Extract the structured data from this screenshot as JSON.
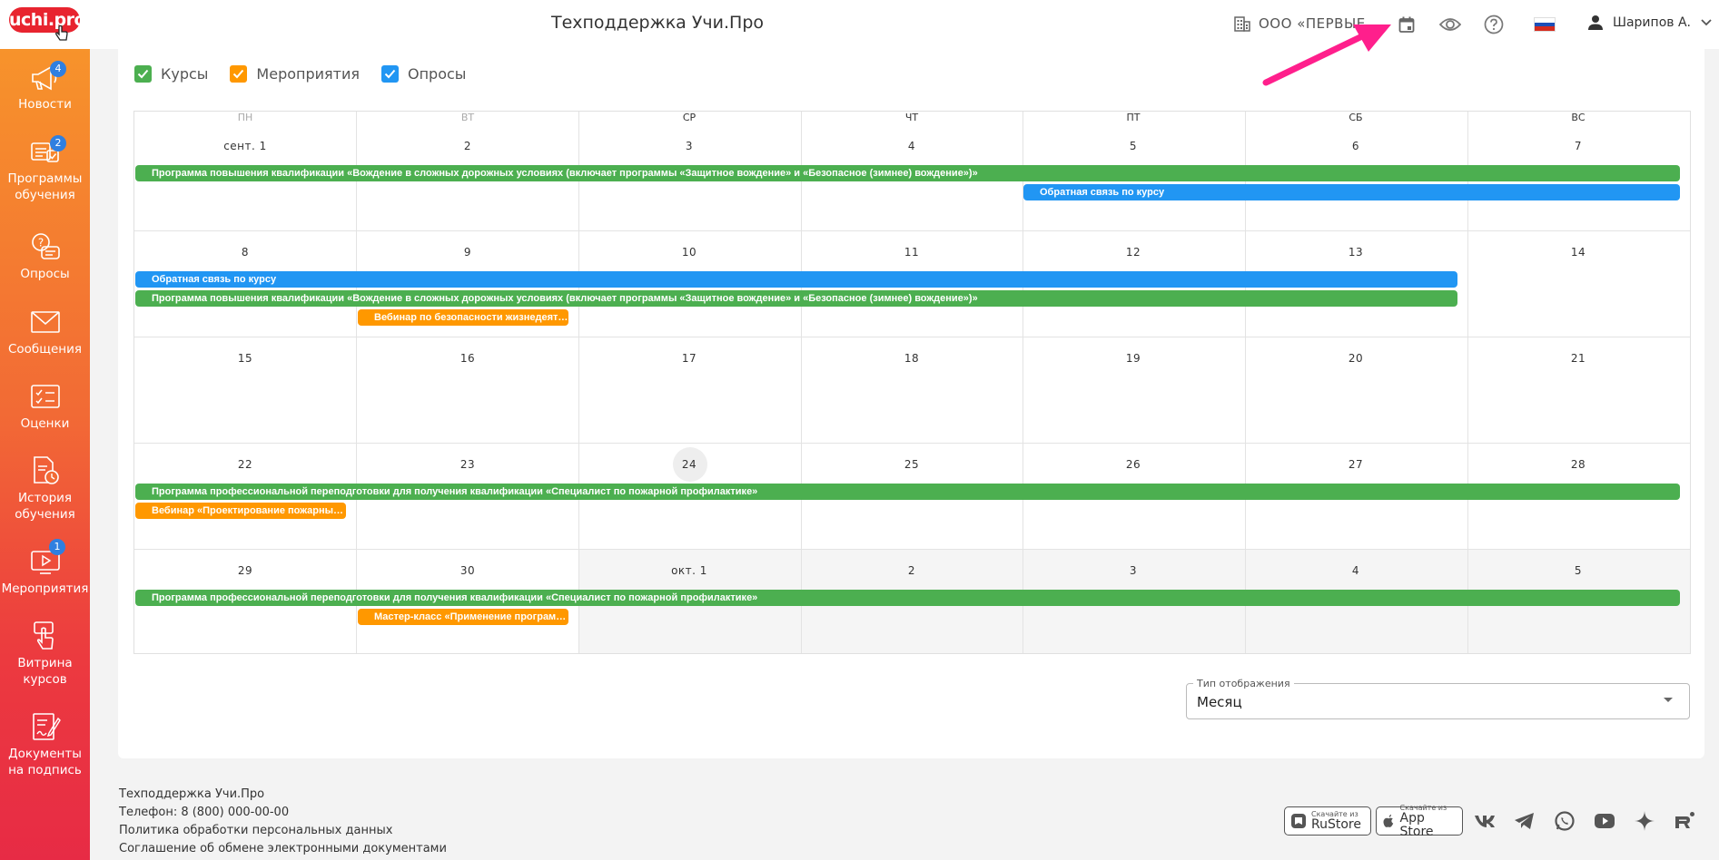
{
  "header": {
    "logo": "uchi.pro",
    "title": "Техподдержка Учи.Про",
    "org": "ООО «ПЕРВЫЕ ...",
    "user": "Шарипов А."
  },
  "sidebar": {
    "items": [
      {
        "label": "Новости",
        "badge": "4"
      },
      {
        "label": "Программы обучения",
        "badge": "2"
      },
      {
        "label": "Опросы"
      },
      {
        "label": "Сообщения"
      },
      {
        "label": "Оценки"
      },
      {
        "label": "История обучения"
      },
      {
        "label": "Мероприятия",
        "badge": "1"
      },
      {
        "label": "Витрина курсов"
      },
      {
        "label": "Документы на подпись"
      }
    ]
  },
  "filters": [
    {
      "label": "Курсы",
      "color": "#4caf50",
      "checked": true
    },
    {
      "label": "Мероприятия",
      "color": "#ff9800",
      "checked": true
    },
    {
      "label": "Опросы",
      "color": "#2196f3",
      "checked": true
    }
  ],
  "calendar": {
    "weekdays": [
      "ПН",
      "ВТ",
      "СР",
      "ЧТ",
      "ПТ",
      "СБ",
      "ВС"
    ],
    "weeks": [
      [
        "сент. 1",
        "2",
        "3",
        "4",
        "5",
        "6",
        "7"
      ],
      [
        "8",
        "9",
        "10",
        "11",
        "12",
        "13",
        "14"
      ],
      [
        "15",
        "16",
        "17",
        "18",
        "19",
        "20",
        "21"
      ],
      [
        "22",
        "23",
        "24",
        "25",
        "26",
        "27",
        "28"
      ],
      [
        "29",
        "30",
        "окт. 1",
        "2",
        "3",
        "4",
        "5"
      ]
    ],
    "today": "24",
    "events": {
      "course_driving": "Программа повышения квалификации «Вождение в сложных дорожных условиях (включает программы «Защитное вождение» и «Безопасное (зимнее) вождение»)»",
      "feedback": "Обратная связь по курсу",
      "webinar_safety": "Вебинар по безопасности жизнедеят…",
      "course_fire": "Программа профессиональной переподготовки для получения квалификации «Специалист по пожарной профилактике»",
      "webinar_design": "Вебинар «Проектирование пожарных …",
      "masterclass": "Мастер-класс «Применение программ…"
    }
  },
  "view_select": {
    "label": "Тип отображения",
    "value": "Месяц"
  },
  "footer": {
    "lines": [
      "Техподдержка Учи.Про",
      "Телефон: 8 (800) 000-00-00",
      "Политика обработки персональных данных",
      "Соглашение об обмене электронными документами"
    ],
    "stores": [
      {
        "small": "Скачайте из",
        "big": "RuStore"
      },
      {
        "small": "Скачайте из",
        "big": "App Store"
      }
    ],
    "socials": [
      "vk-icon",
      "telegram-icon",
      "whatsapp-icon",
      "youtube-icon",
      "dzen-icon",
      "rutube-icon"
    ]
  }
}
